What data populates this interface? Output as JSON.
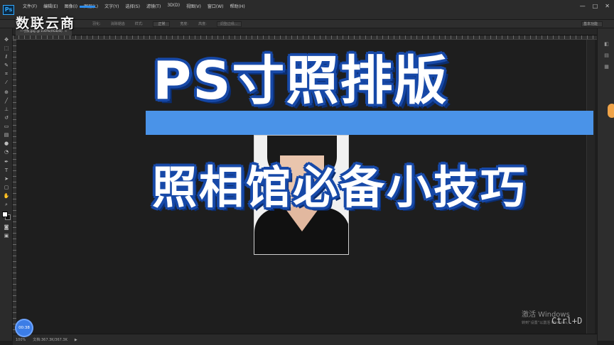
{
  "menubar": {
    "logo": "Ps",
    "items": [
      "文件(F)",
      "编辑(E)",
      "图像(I)",
      "图层(L)",
      "文字(Y)",
      "选择(S)",
      "滤镜(T)",
      "3D(D)",
      "视图(V)",
      "窗口(W)",
      "帮助(H)"
    ],
    "window_controls": [
      "—",
      "□",
      "✕"
    ]
  },
  "watermark": "数联云商",
  "options": {
    "feather_label": "羽化:",
    "antialias_label": "消除锯齿",
    "style_label": "样式:",
    "style_value": "正常",
    "width_label": "宽度:",
    "height_label": "高度:",
    "refine_edge": "调整边缘...",
    "workspace": "基本功能"
  },
  "document": {
    "tab_title": "一寸照.jpg @ 100%(RGB/8)",
    "close": "×"
  },
  "overlay": {
    "title": "PS寸照排版",
    "subtitle": "照相馆必备小技巧"
  },
  "status": {
    "zoom": "100%",
    "doc_size": "文档:367.3K/367.3K",
    "arrow": "▶"
  },
  "timer": "00:38",
  "windows_activation": {
    "title": "激活 Windows",
    "subtitle": "转到“设置”以激活 Windows。"
  },
  "shortcut": "Ctrl+D",
  "colors": {
    "accent_blue": "#4a93e8",
    "title_outline": "#1749a8",
    "timer_blue": "#3c7de6",
    "orange_handle": "#f0a449"
  },
  "tools": [
    "move-icon",
    "marquee-icon",
    "lasso-icon",
    "quick-select-icon",
    "crop-icon",
    "eyedropper-icon",
    "healing-icon",
    "brush-icon",
    "stamp-icon",
    "history-brush-icon",
    "eraser-icon",
    "gradient-icon",
    "blur-icon",
    "dodge-icon",
    "pen-icon",
    "type-icon",
    "path-select-icon",
    "shape-icon",
    "hand-icon",
    "zoom-icon"
  ]
}
